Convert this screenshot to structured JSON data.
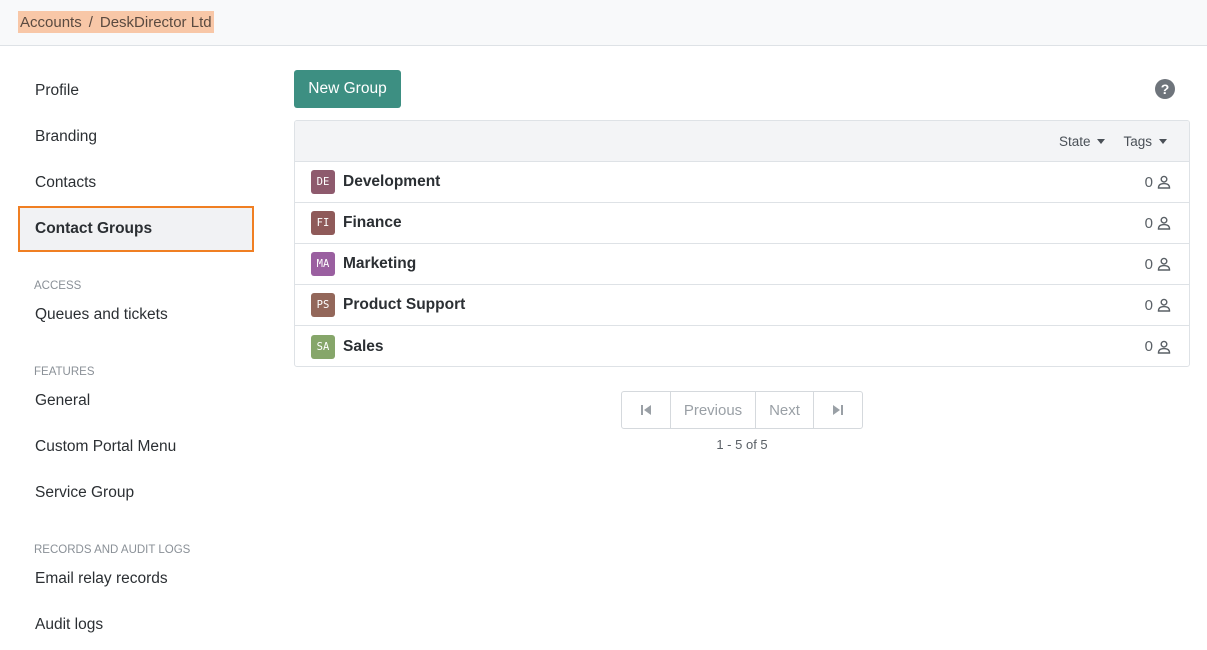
{
  "breadcrumb": {
    "items": [
      "Accounts",
      "DeskDirector Ltd"
    ],
    "separator": "/"
  },
  "sidebar": {
    "items_top": [
      {
        "label": "Profile",
        "active": false
      },
      {
        "label": "Branding",
        "active": false
      },
      {
        "label": "Contacts",
        "active": false
      },
      {
        "label": "Contact Groups",
        "active": true
      }
    ],
    "sections": [
      {
        "header": "ACCESS",
        "items": [
          {
            "label": "Queues and tickets"
          }
        ]
      },
      {
        "header": "FEATURES",
        "items": [
          {
            "label": "General"
          },
          {
            "label": "Custom Portal Menu"
          },
          {
            "label": "Service Group"
          }
        ]
      },
      {
        "header": "RECORDS AND AUDIT LOGS",
        "items": [
          {
            "label": "Email relay records"
          },
          {
            "label": "Audit logs"
          }
        ]
      }
    ]
  },
  "toolbar": {
    "new_group_label": "New Group",
    "help_icon": "question-circle-icon"
  },
  "table": {
    "filters": [
      {
        "label": "State"
      },
      {
        "label": "Tags"
      }
    ],
    "rows": [
      {
        "initials": "DE",
        "name": "Development",
        "count": "0",
        "color": "#8e5a6d"
      },
      {
        "initials": "FI",
        "name": "Finance",
        "count": "0",
        "color": "#8f5a59"
      },
      {
        "initials": "MA",
        "name": "Marketing",
        "count": "0",
        "color": "#9a5fa0"
      },
      {
        "initials": "PS",
        "name": "Product Support",
        "count": "0",
        "color": "#93675a"
      },
      {
        "initials": "SA",
        "name": "Sales",
        "count": "0",
        "color": "#86a66a"
      }
    ]
  },
  "pagination": {
    "previous_label": "Previous",
    "next_label": "Next",
    "info": "1 - 5 of 5"
  },
  "colors": {
    "accent": "#3d8f82",
    "active_outline": "#f07f23",
    "breadcrumb_highlight": "#f8c7a7"
  }
}
